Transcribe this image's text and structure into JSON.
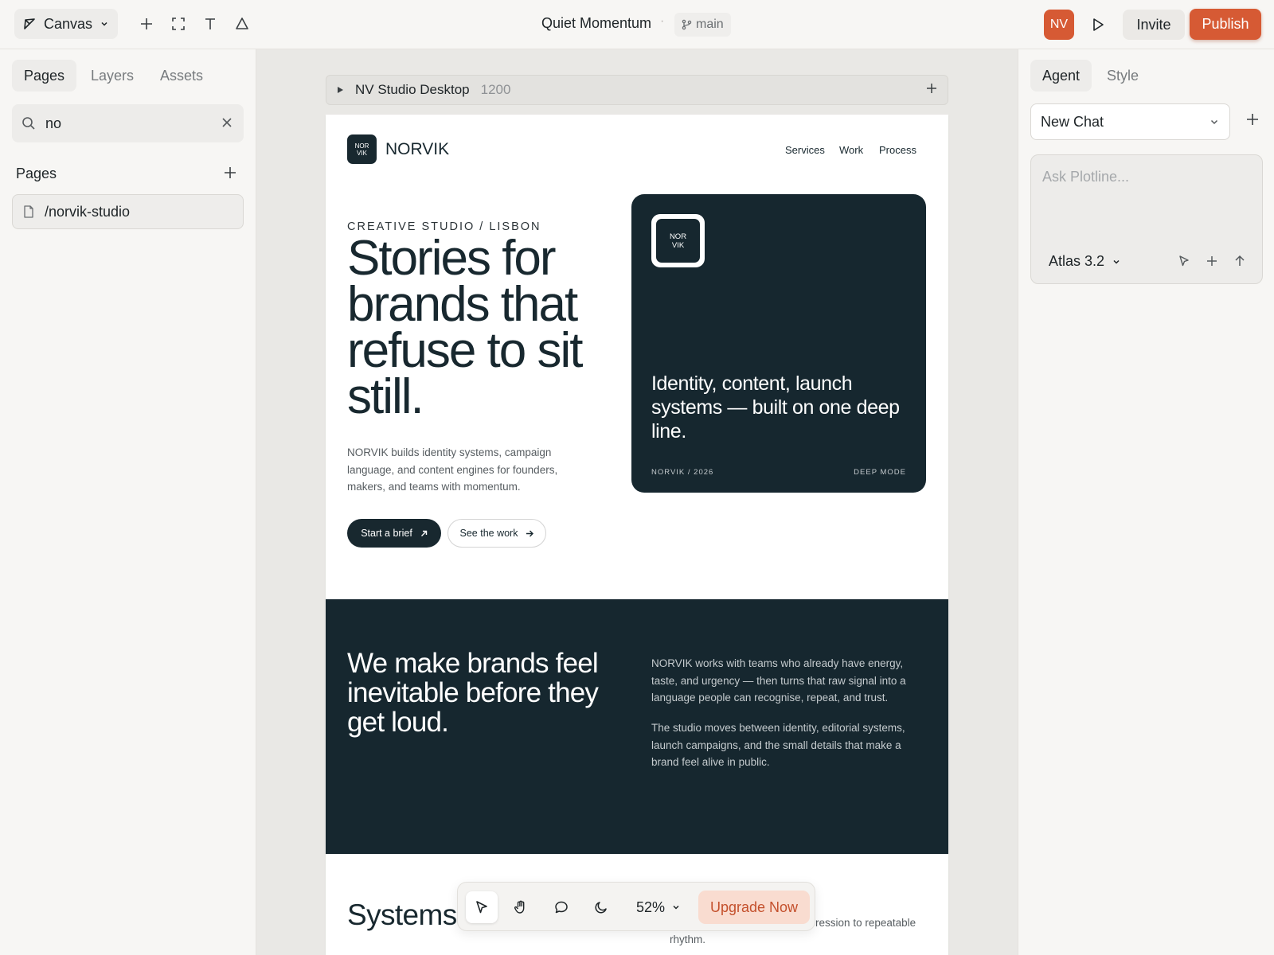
{
  "topbar": {
    "mode_label": "Canvas",
    "doc_title": "Quiet Momentum",
    "separator": "·",
    "branch": "main",
    "avatar": "NV",
    "invite": "Invite",
    "publish": "Publish",
    "colors": {
      "accent": "#d65a34"
    }
  },
  "left_panel": {
    "tabs": [
      {
        "label": "Pages"
      },
      {
        "label": "Layers"
      },
      {
        "label": "Assets"
      }
    ],
    "search_value": "no",
    "pages_heading": "Pages",
    "pages": [
      {
        "label": "/norvik-studio"
      }
    ]
  },
  "canvas": {
    "frame_name": "NV Studio Desktop",
    "frame_width": "1200",
    "site": {
      "logo_text": [
        "NOR",
        "VIK"
      ],
      "brand": "NORVIK",
      "nav": [
        "Services",
        "Work",
        "Process"
      ],
      "kicker": "CREATIVE STUDIO / LISBON",
      "headline": "Stories for brands that refuse to sit still.",
      "lede": "NORVIK builds identity systems, campaign language, and content engines for founders, makers, and teams with momentum.",
      "cta_primary": "Start a brief",
      "cta_secondary": "See the work",
      "card": {
        "logo_text": [
          "NOR",
          "VIK"
        ],
        "text": "Identity, content, launch systems — built on one deep line.",
        "foot_left": "NORVIK / 2026",
        "foot_right": "DEEP MODE"
      },
      "about": {
        "heading": "We make brands feel inevitable before they get loud.",
        "p1": "NORVIK works with teams who already have energy, taste, and urgency — then turns that raw signal into a language people can recognise, repeat, and trust.",
        "p2": "The studio moves between identity, editorial systems, launch campaigns, and the small details that make a brand feel alive in public."
      },
      "systems": {
        "heading": "Systems",
        "text_visible": "something you can\nrun without us — from first impression to repeatable\nrhythm."
      },
      "colors": {
        "deep": "#16272f"
      }
    }
  },
  "floating_toolbar": {
    "zoom": "52%",
    "upgrade": "Upgrade Now"
  },
  "right_panel": {
    "tabs": [
      {
        "label": "Agent"
      },
      {
        "label": "Style"
      }
    ],
    "chat_select": "New Chat",
    "prompt_placeholder": "Ask Plotline...",
    "model": "Atlas 3.2"
  }
}
